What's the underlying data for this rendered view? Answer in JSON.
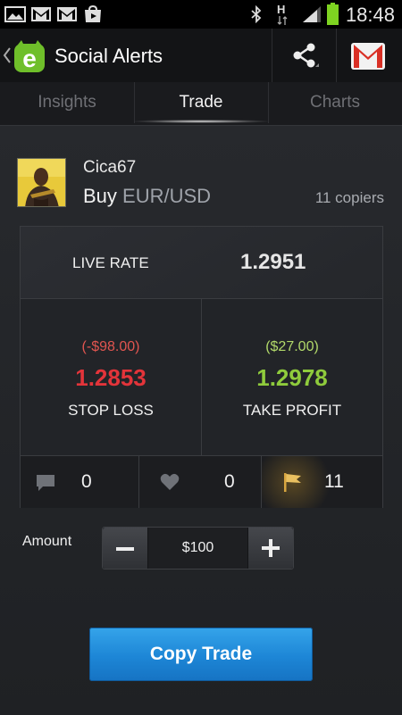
{
  "status_bar": {
    "time": "18:48",
    "network": "H"
  },
  "app": {
    "title": "Social Alerts"
  },
  "tabs": [
    {
      "label": "Insights",
      "active": false
    },
    {
      "label": "Trade",
      "active": true
    },
    {
      "label": "Charts",
      "active": false
    }
  ],
  "trade": {
    "username": "Cica67",
    "action": "Buy",
    "pair": "EUR/USD",
    "copiers": "11 copiers",
    "live_rate_label": "LIVE RATE",
    "live_rate": "1.2951",
    "stop_loss": {
      "pl": "(-$98.00)",
      "rate": "1.2853",
      "label": "STOP LOSS"
    },
    "take_profit": {
      "pl": "($27.00)",
      "rate": "1.2978",
      "label": "TAKE PROFIT"
    },
    "stats": {
      "comments": "0",
      "likes": "0",
      "flags": "11"
    }
  },
  "amount": {
    "label": "Amount",
    "value": "$100"
  },
  "copy_button": {
    "label": "Copy Trade"
  },
  "colors": {
    "accent_blue": "#1d86d6",
    "loss_red": "#e3343a",
    "profit_green": "#8fcb3c",
    "brand_green": "#6fbf2a"
  },
  "icons": [
    "gallery-icon",
    "gmail-icon",
    "play-store-icon",
    "bluetooth-icon",
    "signal-icon",
    "battery-icon",
    "back-chevron-icon",
    "etoro-logo-icon",
    "share-icon",
    "gmail-icon",
    "comment-icon",
    "heart-icon",
    "flag-icon",
    "minus-icon",
    "plus-icon"
  ]
}
